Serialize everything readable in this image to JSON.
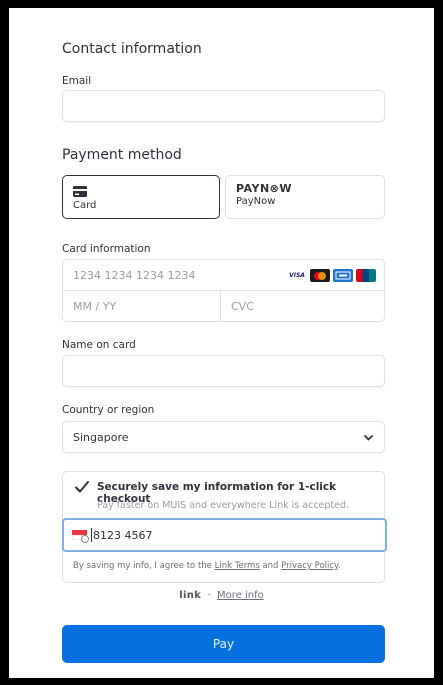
{
  "contact": {
    "title": "Contact information",
    "email_label": "Email",
    "email_value": ""
  },
  "payment": {
    "title": "Payment method",
    "tabs": [
      {
        "label": "Card",
        "icon": "card-icon",
        "selected": true
      },
      {
        "wordmark": "PAYN⊗W",
        "label": "PayNow",
        "icon": "paynow-logo",
        "selected": false
      }
    ]
  },
  "card_info": {
    "label": "Card information",
    "number_placeholder": "1234 1234 1234 1234",
    "expiry_placeholder": "MM / YY",
    "cvc_placeholder": "CVC",
    "brands": [
      "visa-icon",
      "mastercard-icon",
      "amex-icon",
      "unionpay-icon"
    ],
    "visa_text": "VISA"
  },
  "name_on_card": {
    "label": "Name on card",
    "value": ""
  },
  "country": {
    "label": "Country or region",
    "value": "Singapore"
  },
  "link_save": {
    "title": "Securely save my information for 1-click checkout",
    "subtitle": "Pay faster on MUIS and everywhere Link is accepted.",
    "checked": true,
    "phone_value": "8123 4567",
    "terms_prefix": "By saving my info, I agree to the ",
    "terms_link": "Link Terms",
    "terms_and": " and ",
    "privacy_link": "Privacy Policy",
    "terms_suffix": "."
  },
  "footer": {
    "link_logo": "link",
    "separator": "·",
    "more_info": "More info"
  },
  "pay_button": {
    "label": "Pay"
  },
  "colors": {
    "accent": "#0570de",
    "border": "#e0e0e6",
    "text": "#30313d",
    "placeholder": "#9b9ba6"
  }
}
